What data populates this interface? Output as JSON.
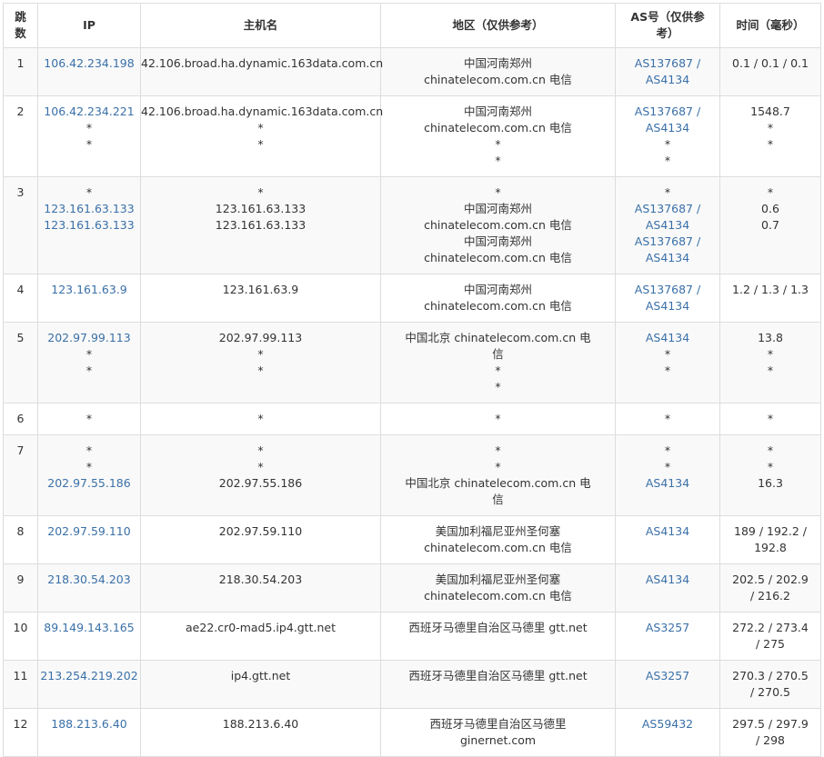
{
  "table": {
    "headers": {
      "hop": "跳数",
      "ip": "IP",
      "host": "主机名",
      "region": "地区（仅供参考）",
      "asn": "AS号（仅供参考）",
      "time": "时间（毫秒）"
    },
    "rows": [
      {
        "hop": "1",
        "ip": [
          "106.42.234.198"
        ],
        "host": [
          "42.106.broad.ha.dynamic.163data.com.cn"
        ],
        "region": [
          "中国河南郑州 chinatelecom.com.cn 电信"
        ],
        "asn": [
          "AS137687 / AS4134"
        ],
        "time": [
          "0.1 / 0.1 / 0.1"
        ]
      },
      {
        "hop": "2",
        "ip": [
          "106.42.234.221",
          "*",
          "*"
        ],
        "host": [
          "42.106.broad.ha.dynamic.163data.com.cn",
          "*",
          "*"
        ],
        "region": [
          "中国河南郑州 chinatelecom.com.cn 电信",
          "*",
          "*"
        ],
        "asn": [
          "AS137687 / AS4134",
          "*",
          "*"
        ],
        "time": [
          "1548.7",
          "*",
          "*"
        ]
      },
      {
        "hop": "3",
        "ip": [
          "*",
          "123.161.63.133",
          "123.161.63.133"
        ],
        "host": [
          "*",
          "123.161.63.133",
          "123.161.63.133"
        ],
        "region": [
          "*",
          "中国河南郑州 chinatelecom.com.cn 电信",
          "中国河南郑州 chinatelecom.com.cn 电信"
        ],
        "asn": [
          "*",
          "AS137687 / AS4134",
          "AS137687 / AS4134"
        ],
        "time": [
          "*",
          "0.6",
          "0.7"
        ]
      },
      {
        "hop": "4",
        "ip": [
          "123.161.63.9"
        ],
        "host": [
          "123.161.63.9"
        ],
        "region": [
          "中国河南郑州 chinatelecom.com.cn 电信"
        ],
        "asn": [
          "AS137687 / AS4134"
        ],
        "time": [
          "1.2 / 1.3 / 1.3"
        ]
      },
      {
        "hop": "5",
        "ip": [
          "202.97.99.113",
          "*",
          "*"
        ],
        "host": [
          "202.97.99.113",
          "*",
          "*"
        ],
        "region": [
          "中国北京 chinatelecom.com.cn 电信",
          "*",
          "*"
        ],
        "asn": [
          "AS4134",
          "*",
          "*"
        ],
        "time": [
          "13.8",
          "*",
          "*"
        ]
      },
      {
        "hop": "6",
        "ip": [
          "*"
        ],
        "host": [
          "*"
        ],
        "region": [
          "*"
        ],
        "asn": [
          "*"
        ],
        "time": [
          "*"
        ]
      },
      {
        "hop": "7",
        "ip": [
          "*",
          "*",
          "202.97.55.186"
        ],
        "host": [
          "*",
          "*",
          "202.97.55.186"
        ],
        "region": [
          "*",
          "*",
          "中国北京 chinatelecom.com.cn 电信"
        ],
        "asn": [
          "*",
          "*",
          "AS4134"
        ],
        "time": [
          "*",
          "*",
          "16.3"
        ]
      },
      {
        "hop": "8",
        "ip": [
          "202.97.59.110"
        ],
        "host": [
          "202.97.59.110"
        ],
        "region": [
          "美国加利福尼亚州圣何塞 chinatelecom.com.cn 电信"
        ],
        "asn": [
          "AS4134"
        ],
        "time": [
          "189 / 192.2 / 192.8"
        ]
      },
      {
        "hop": "9",
        "ip": [
          "218.30.54.203"
        ],
        "host": [
          "218.30.54.203"
        ],
        "region": [
          "美国加利福尼亚州圣何塞 chinatelecom.com.cn 电信"
        ],
        "asn": [
          "AS4134"
        ],
        "time": [
          "202.5 / 202.9 / 216.2"
        ]
      },
      {
        "hop": "10",
        "ip": [
          "89.149.143.165"
        ],
        "host": [
          "ae22.cr0-mad5.ip4.gtt.net"
        ],
        "region": [
          "西班牙马德里自治区马德里 gtt.net"
        ],
        "asn": [
          "AS3257"
        ],
        "time": [
          "272.2 / 273.4 / 275"
        ]
      },
      {
        "hop": "11",
        "ip": [
          "213.254.219.202"
        ],
        "host": [
          "ip4.gtt.net"
        ],
        "region": [
          "西班牙马德里自治区马德里 gtt.net"
        ],
        "asn": [
          "AS3257"
        ],
        "time": [
          "270.3 / 270.5 / 270.5"
        ]
      },
      {
        "hop": "12",
        "ip": [
          "188.213.6.40"
        ],
        "host": [
          "188.213.6.40"
        ],
        "region": [
          "西班牙马德里自治区马德里 ginernet.com"
        ],
        "asn": [
          "AS59432"
        ],
        "time": [
          "297.5 / 297.9 / 298"
        ]
      }
    ]
  },
  "colors": {
    "link": "#3a70a8",
    "text": "#333333",
    "border": "#dddddd",
    "row_alt": "#f9f9f9"
  }
}
